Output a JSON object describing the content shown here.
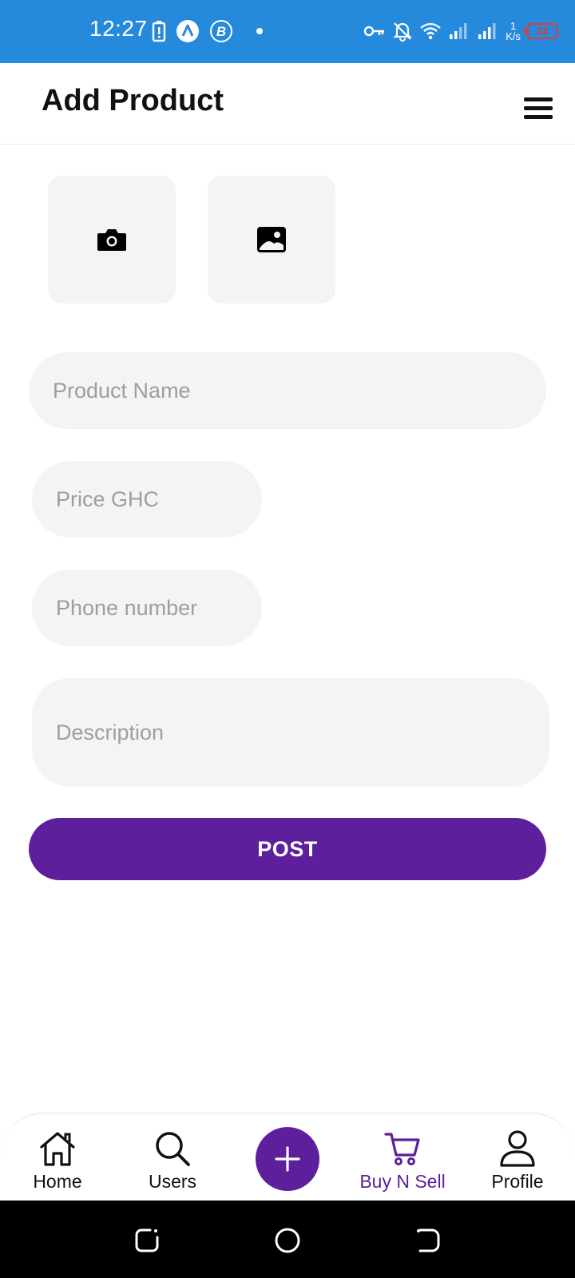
{
  "status_bar": {
    "time": "12:27",
    "net_speed_value": "1",
    "net_speed_unit": "K/s",
    "battery_level": "14",
    "icons": [
      "battery-alert-icon",
      "app-a-icon",
      "app-b-icon",
      "dot-icon",
      "vpn-key-icon",
      "bell-off-icon",
      "wifi-icon",
      "signal-icon",
      "signal-icon"
    ]
  },
  "header": {
    "title": "Add Product",
    "menu_icon": "hamburger-menu-icon"
  },
  "image_pickers": [
    {
      "icon": "camera-icon"
    },
    {
      "icon": "gallery-icon"
    }
  ],
  "form": {
    "product_name_placeholder": "Product Name",
    "price_placeholder": "Price GHC",
    "phone_placeholder": "Phone number",
    "description_placeholder": "Description",
    "post_label": "POST"
  },
  "bottom_nav": {
    "items": [
      {
        "label": "Home",
        "icon": "home-icon"
      },
      {
        "label": "Users",
        "icon": "search-icon"
      },
      {
        "label": "",
        "icon": "plus-icon"
      },
      {
        "label": "Buy N Sell",
        "icon": "cart-icon",
        "active": true
      },
      {
        "label": "Profile",
        "icon": "person-icon"
      }
    ]
  },
  "colors": {
    "status_bar": "#2589dc",
    "accent": "#5d1f9b",
    "field_bg": "#f4f4f4",
    "battery_low": "#e53935"
  }
}
